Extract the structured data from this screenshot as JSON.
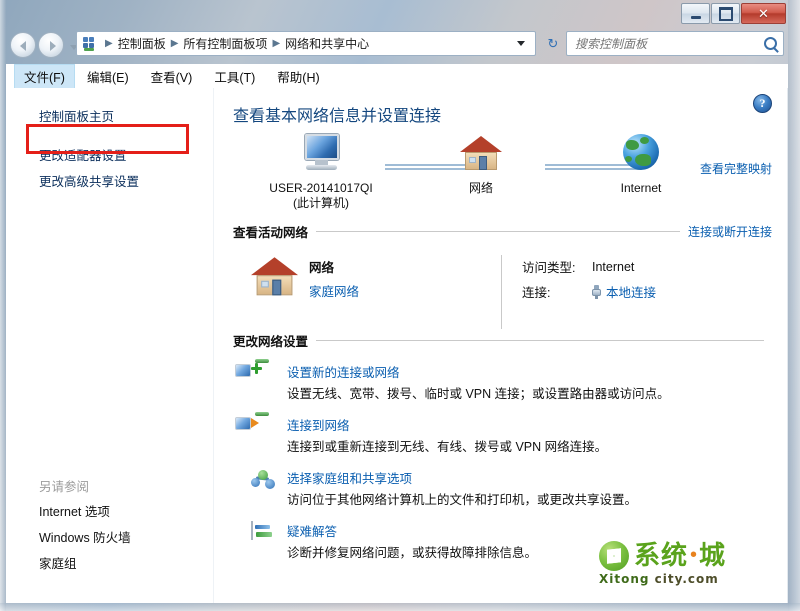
{
  "window": {
    "controls": {
      "minimize": "",
      "maximize": "",
      "close": "✕"
    }
  },
  "nav": {
    "back_tooltip": "",
    "forward_tooltip": "",
    "breadcrumb": [
      "控制面板",
      "所有控制面板项",
      "网络和共享中心"
    ],
    "separator": "▶",
    "refresh_icon": "↻"
  },
  "search": {
    "placeholder": "搜索控制面板",
    "value": ""
  },
  "menubar": {
    "items": [
      {
        "label": "文件(F)",
        "active": true
      },
      {
        "label": "编辑(E)",
        "active": false
      },
      {
        "label": "查看(V)",
        "active": false
      },
      {
        "label": "工具(T)",
        "active": false
      },
      {
        "label": "帮助(H)",
        "active": false
      }
    ]
  },
  "sidebar": {
    "links": [
      {
        "label": "控制面板主页"
      },
      {
        "label": "更改适配器设置"
      },
      {
        "label": "更改高级共享设置"
      }
    ],
    "see_also_heading": "另请参阅",
    "see_also": [
      {
        "label": "Internet 选项"
      },
      {
        "label": "Windows 防火墙"
      },
      {
        "label": "家庭组"
      }
    ],
    "highlight_color": "#e41f18"
  },
  "main": {
    "help_label": "?",
    "page_title": "查看基本网络信息并设置连接",
    "view_full_map": "查看完整映射",
    "network_map": {
      "computer": {
        "name": "USER-20141017QI",
        "sub": "(此计算机)",
        "icon": "monitor-icon"
      },
      "network": {
        "name": "网络",
        "sub": "",
        "icon": "house-icon"
      },
      "internet": {
        "name": "Internet",
        "sub": "",
        "icon": "globe-icon"
      }
    },
    "active_networks": {
      "heading": "查看活动网络",
      "action": "连接或断开连接",
      "network_name": "网络",
      "network_type": "家庭网络",
      "access_type_label": "访问类型:",
      "access_type_value": "Internet",
      "connection_label": "连接:",
      "connection_value": "本地连接"
    },
    "change_settings": {
      "heading": "更改网络设置",
      "tasks": [
        {
          "icon": "new-connection-icon",
          "link": "设置新的连接或网络",
          "desc": "设置无线、宽带、拨号、临时或 VPN 连接；或设置路由器或访问点。"
        },
        {
          "icon": "connect-network-icon",
          "link": "连接到网络",
          "desc": "连接到或重新连接到无线、有线、拨号或 VPN 网络连接。"
        },
        {
          "icon": "homegroup-icon",
          "link": "选择家庭组和共享选项",
          "desc": "访问位于其他网络计算机上的文件和打印机，或更改共享设置。"
        },
        {
          "icon": "troubleshoot-icon",
          "link": "疑难解答",
          "desc": "诊断并修复网络问题，或获得故障排除信息。"
        }
      ]
    }
  },
  "watermark": {
    "cn": "系统",
    "dot": "•",
    "cn2": "城",
    "en_a": "Xitong",
    "en_b": "city",
    "en_c": ".com"
  }
}
